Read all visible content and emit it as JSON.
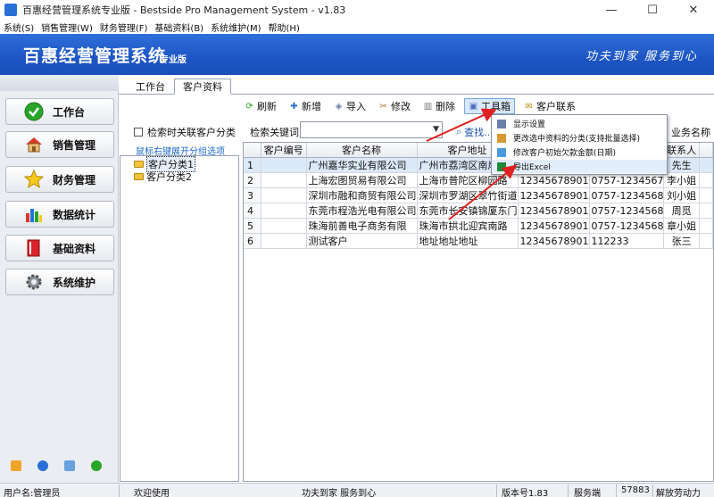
{
  "window": {
    "title": "百惠经营管理系统专业版 - Bestside Pro Management System - v1.83",
    "min": "—",
    "max": "☐",
    "close": "✕"
  },
  "menu": [
    "系统(S)",
    "销售管理(W)",
    "财务管理(F)",
    "基础资料(B)",
    "系统维护(M)",
    "帮助(H)"
  ],
  "banner": {
    "title": "百惠经营管理系统",
    "edition": "专业版",
    "slogan": "功夫到家  服务到心"
  },
  "nav": [
    {
      "label": "工作台",
      "icon": "check-icon"
    },
    {
      "label": "销售管理",
      "icon": "house-icon"
    },
    {
      "label": "财务管理",
      "icon": "star-icon"
    },
    {
      "label": "数据统计",
      "icon": "bar-chart-icon"
    },
    {
      "label": "基础资料",
      "icon": "book-icon"
    },
    {
      "label": "系统维护",
      "icon": "gear-icon"
    }
  ],
  "tabs": [
    "工作台",
    "客户资料"
  ],
  "toolbar": {
    "refresh": "刷新",
    "add": "新增",
    "import": "导入",
    "edit": "修改",
    "delete": "删除",
    "toolbox": "工具箱",
    "contact": "客户联系"
  },
  "tree": {
    "checkbox_label": "检索时关联客户分类",
    "hint": "鼠标右键展开分组选项",
    "items": [
      "客户分类1",
      "客户分类2"
    ]
  },
  "search": {
    "label": "检索关键词",
    "value": "",
    "button": "查找..."
  },
  "dropdown": [
    "显示设置",
    "更改选中资料的分类(支持批量选择)",
    "修改客户初始欠款金额(日期)",
    "导出Excel"
  ],
  "grid": {
    "headers": [
      "客户编号",
      "客户名称",
      "客户地址",
      "",
      "",
      "联系人"
    ],
    "extra_header": "业务名称",
    "rows": [
      [
        "1",
        "",
        "广州嘉华实业有限公司",
        "广州市荔湾区南岸路",
        "",
        "",
        "先生"
      ],
      [
        "2",
        "",
        "上海宏图贸易有限公司",
        "上海市普陀区柳园路",
        "12345678901",
        "0757-1234567",
        "李小姐"
      ],
      [
        "3",
        "",
        "深圳市融和商贸有限公司",
        "深圳市罗湖区翠竹街道",
        "12345678901",
        "0757-1234568",
        "刘小姐"
      ],
      [
        "4",
        "",
        "东莞市程浩光电有限公司",
        "东莞市长安镇锦厦东门",
        "12345678901",
        "0757-1234568",
        "周觅"
      ],
      [
        "5",
        "",
        "珠海前善电子商务有限",
        "珠海市拱北迎宾南路",
        "12345678901",
        "0757-1234568",
        "章小姐"
      ],
      [
        "6",
        "",
        "测试客户",
        "地址地址地址",
        "12345678901",
        "112233",
        "张三"
      ]
    ]
  },
  "status": {
    "user": "用户名:管理员",
    "welcome": "欢迎使用",
    "slogan": "功夫到家 服务到心",
    "version": "版本号1.83",
    "server": "服务端",
    "port": "57883",
    "badge": "解放劳动力"
  }
}
